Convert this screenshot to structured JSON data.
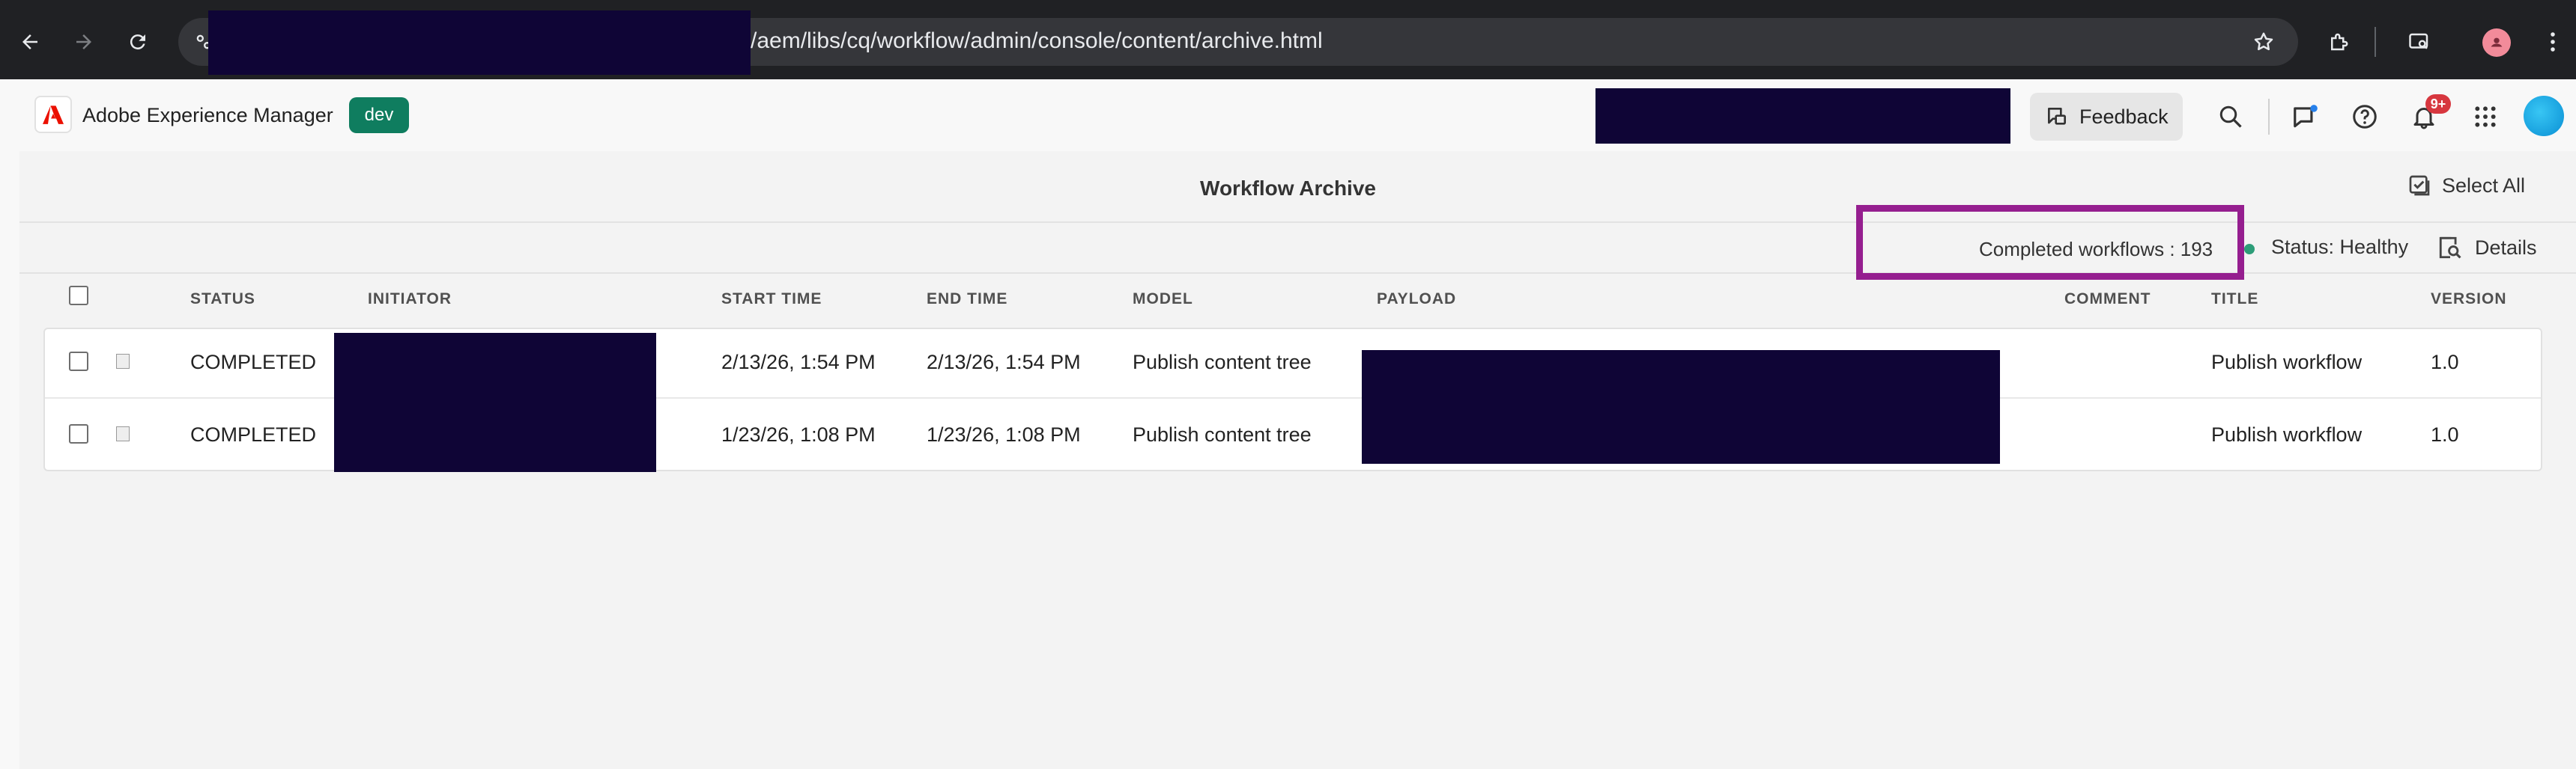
{
  "browser": {
    "url_suffix": "/aem/libs/cq/workflow/admin/console/content/archive.html",
    "back_icon": "arrow-left-icon",
    "forward_icon": "arrow-right-icon",
    "reload_icon": "reload-icon",
    "bookmark_icon": "star-icon",
    "extensions_icon": "puzzle-icon",
    "tab_search_icon": "tab-search-icon",
    "menu_icon": "more-vertical-icon"
  },
  "header": {
    "product_name": "Adobe Experience Manager",
    "env_badge": "dev",
    "feedback_label": "Feedback",
    "notification_count": "9+",
    "colors": {
      "env_badge": "#0f7d5f",
      "notification_badge": "#d7373f",
      "highlight": "#951e8f"
    }
  },
  "page": {
    "title": "Workflow Archive",
    "select_all_label": "Select All",
    "completed_text": "Completed workflows : 193",
    "status_text": "Status: Healthy",
    "details_label": "Details"
  },
  "table": {
    "columns": [
      "STATUS",
      "INITIATOR",
      "START TIME",
      "END TIME",
      "MODEL",
      "PAYLOAD",
      "COMMENT",
      "TITLE",
      "VERSION"
    ],
    "rows": [
      {
        "status": "COMPLETED",
        "start": "2/13/26, 1:54 PM",
        "end": "2/13/26, 1:54 PM",
        "model": "Publish content tree",
        "comment": "",
        "title": "Publish workflow",
        "version": "1.0"
      },
      {
        "status": "COMPLETED",
        "start": "1/23/26, 1:08 PM",
        "end": "1/23/26, 1:08 PM",
        "model": "Publish content tree",
        "comment": "",
        "title": "Publish workflow",
        "version": "1.0"
      }
    ]
  }
}
